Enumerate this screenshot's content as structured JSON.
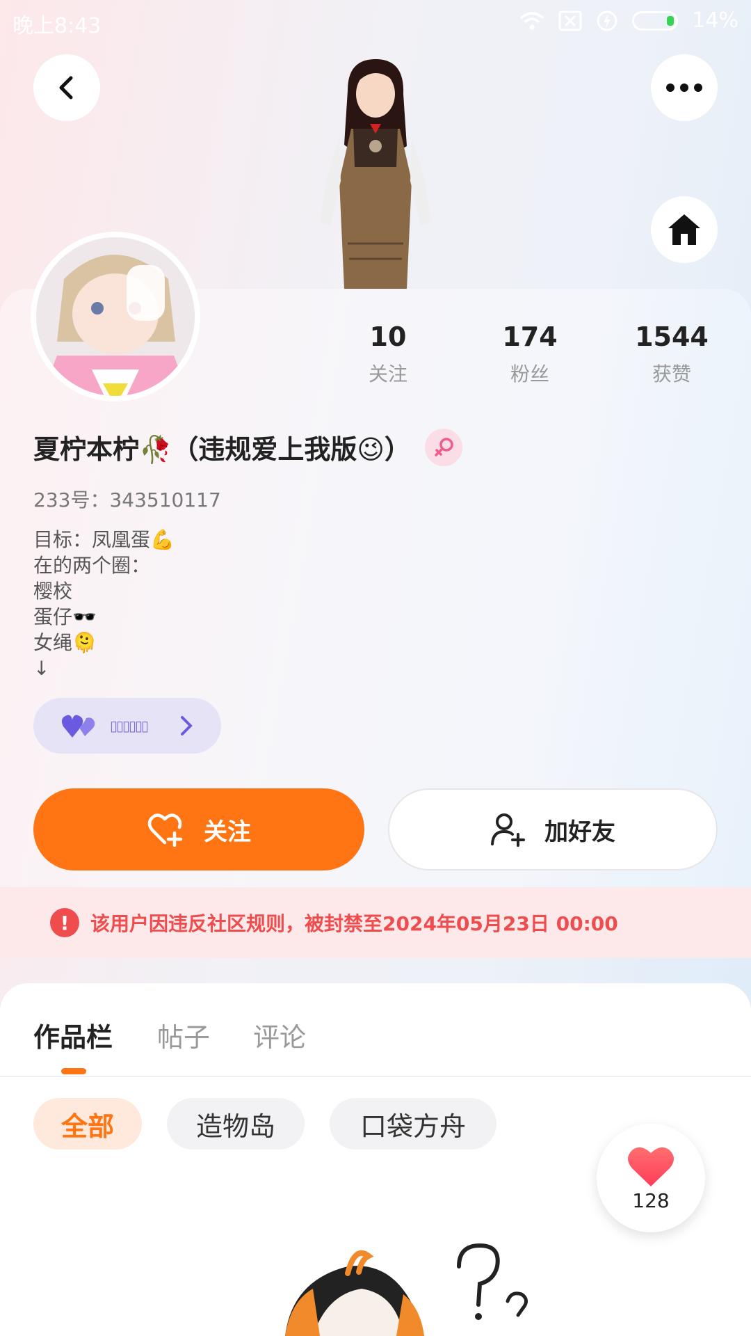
{
  "status_bar": {
    "time": "晚上8:43",
    "battery": "14%",
    "icons": [
      "wifi-icon",
      "sim-disabled-icon",
      "charging-icon",
      "battery-icon"
    ]
  },
  "header": {
    "back_icon": "chevron-left-icon",
    "more_icon": "more-dots-icon",
    "home_icon": "home-icon"
  },
  "stats": [
    {
      "count": "10",
      "label": "关注"
    },
    {
      "count": "174",
      "label": "粉丝"
    },
    {
      "count": "1544",
      "label": "获赞"
    }
  ],
  "profile": {
    "nickname": "夏柠本柠🥀（违规爱上我版😉）",
    "gender": "female",
    "uid": "233号：343510117",
    "bio_lines": [
      "目标：凤凰蛋💪",
      "在的两个圈：",
      "樱校",
      "蛋仔🕶️",
      "女绳🫠",
      "↓"
    ],
    "badge_label": "▯▯▯▯▯▯"
  },
  "actions": {
    "follow_label": "关注",
    "add_friend_label": "加好友"
  },
  "ban_notice": {
    "icon": "!",
    "text": "该用户因违反社区规则，被封禁至2024年05月23日 00:00"
  },
  "tabs": [
    {
      "label": "作品栏",
      "active": true
    },
    {
      "label": "帖子",
      "active": false
    },
    {
      "label": "评论",
      "active": false
    }
  ],
  "filters": [
    {
      "label": "全部",
      "active": true
    },
    {
      "label": "造物岛",
      "active": false
    },
    {
      "label": "口袋方舟",
      "active": false
    }
  ],
  "like_button": {
    "count": "128"
  },
  "colors": {
    "accent": "#ff7413",
    "ban_red": "#ef4d4d",
    "badge_purple": "#7b6fd8"
  }
}
